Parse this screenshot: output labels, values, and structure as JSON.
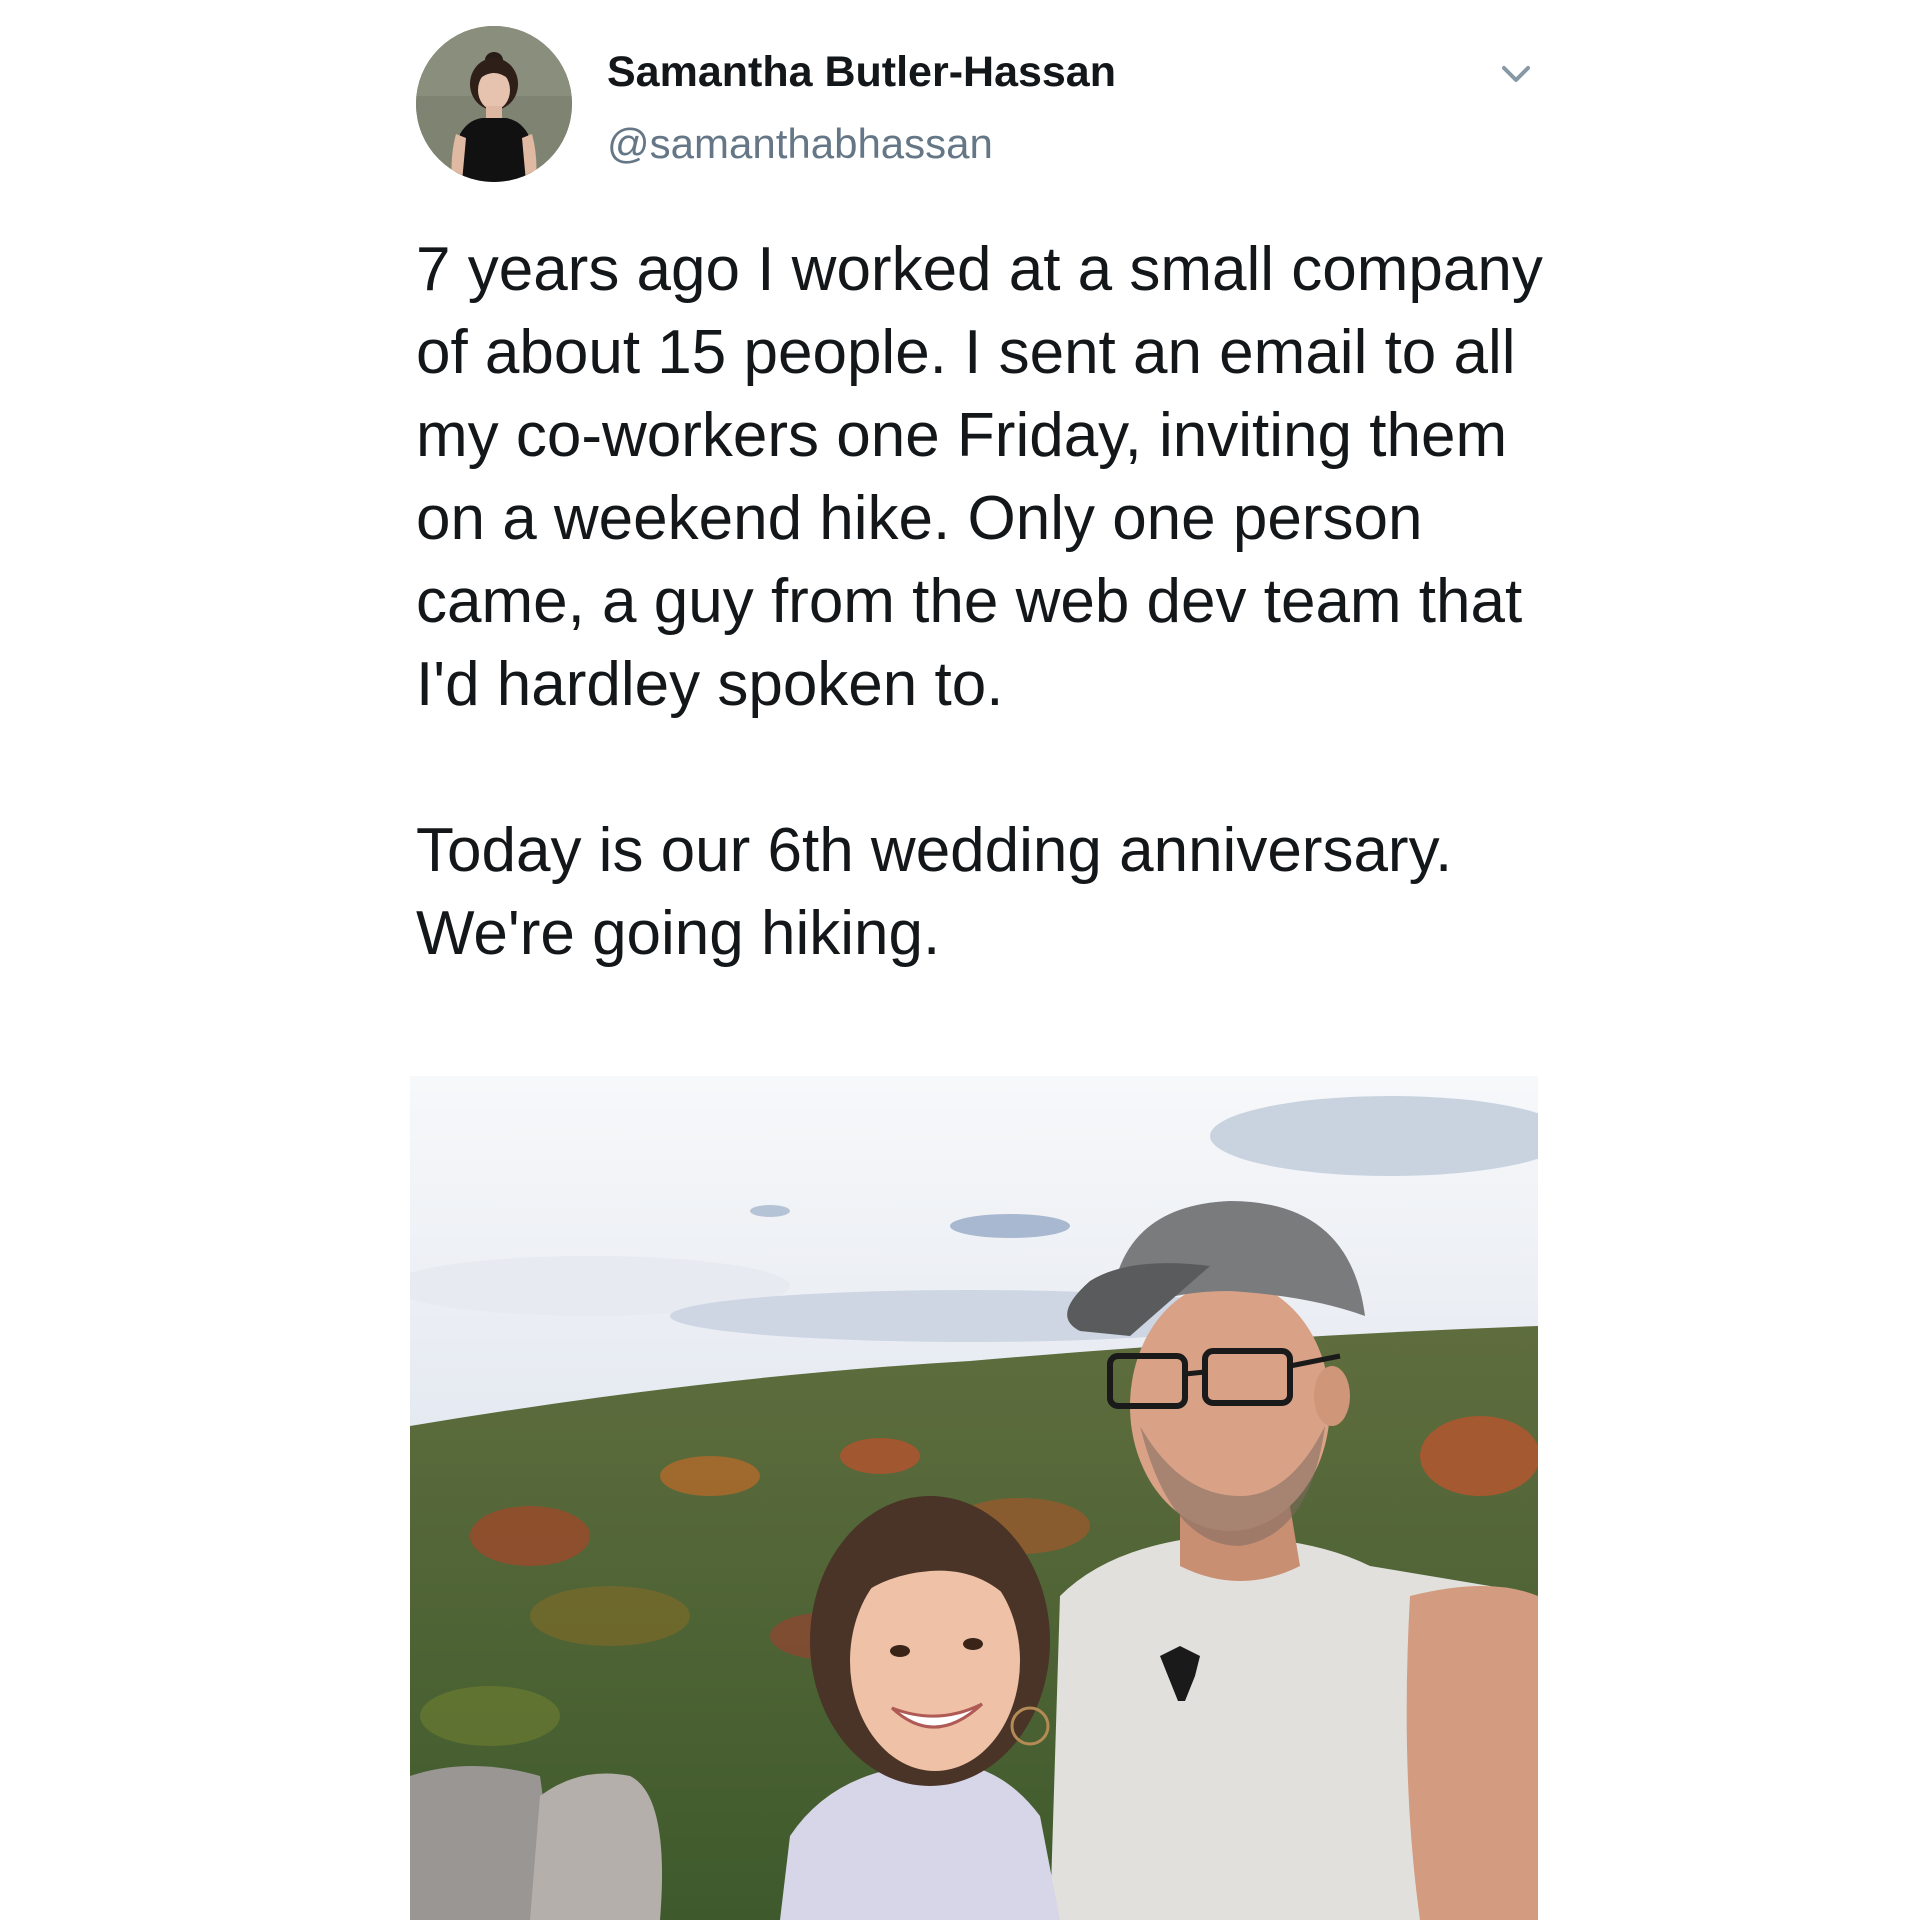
{
  "tweet": {
    "author": {
      "display_name": "Samantha Butler-Hassan",
      "handle": "@samanthabhassan",
      "avatar_icon": "profile-photo"
    },
    "menu_icon": "chevron-down-icon",
    "paragraphs": [
      "7 years ago I worked at a small company of about 15 people. I sent an email to all my co-workers one Friday, inviting them on a weekend hike. Only one person came, a guy from the web dev team that I'd hardley spoken to.",
      "Today is our 6th wedding anniversary. We're going hiking."
    ],
    "media": {
      "type": "photo"
    }
  },
  "colors": {
    "text": "#14171a",
    "secondary_text": "#657786",
    "caret": "#8899a6",
    "background": "#ffffff"
  }
}
